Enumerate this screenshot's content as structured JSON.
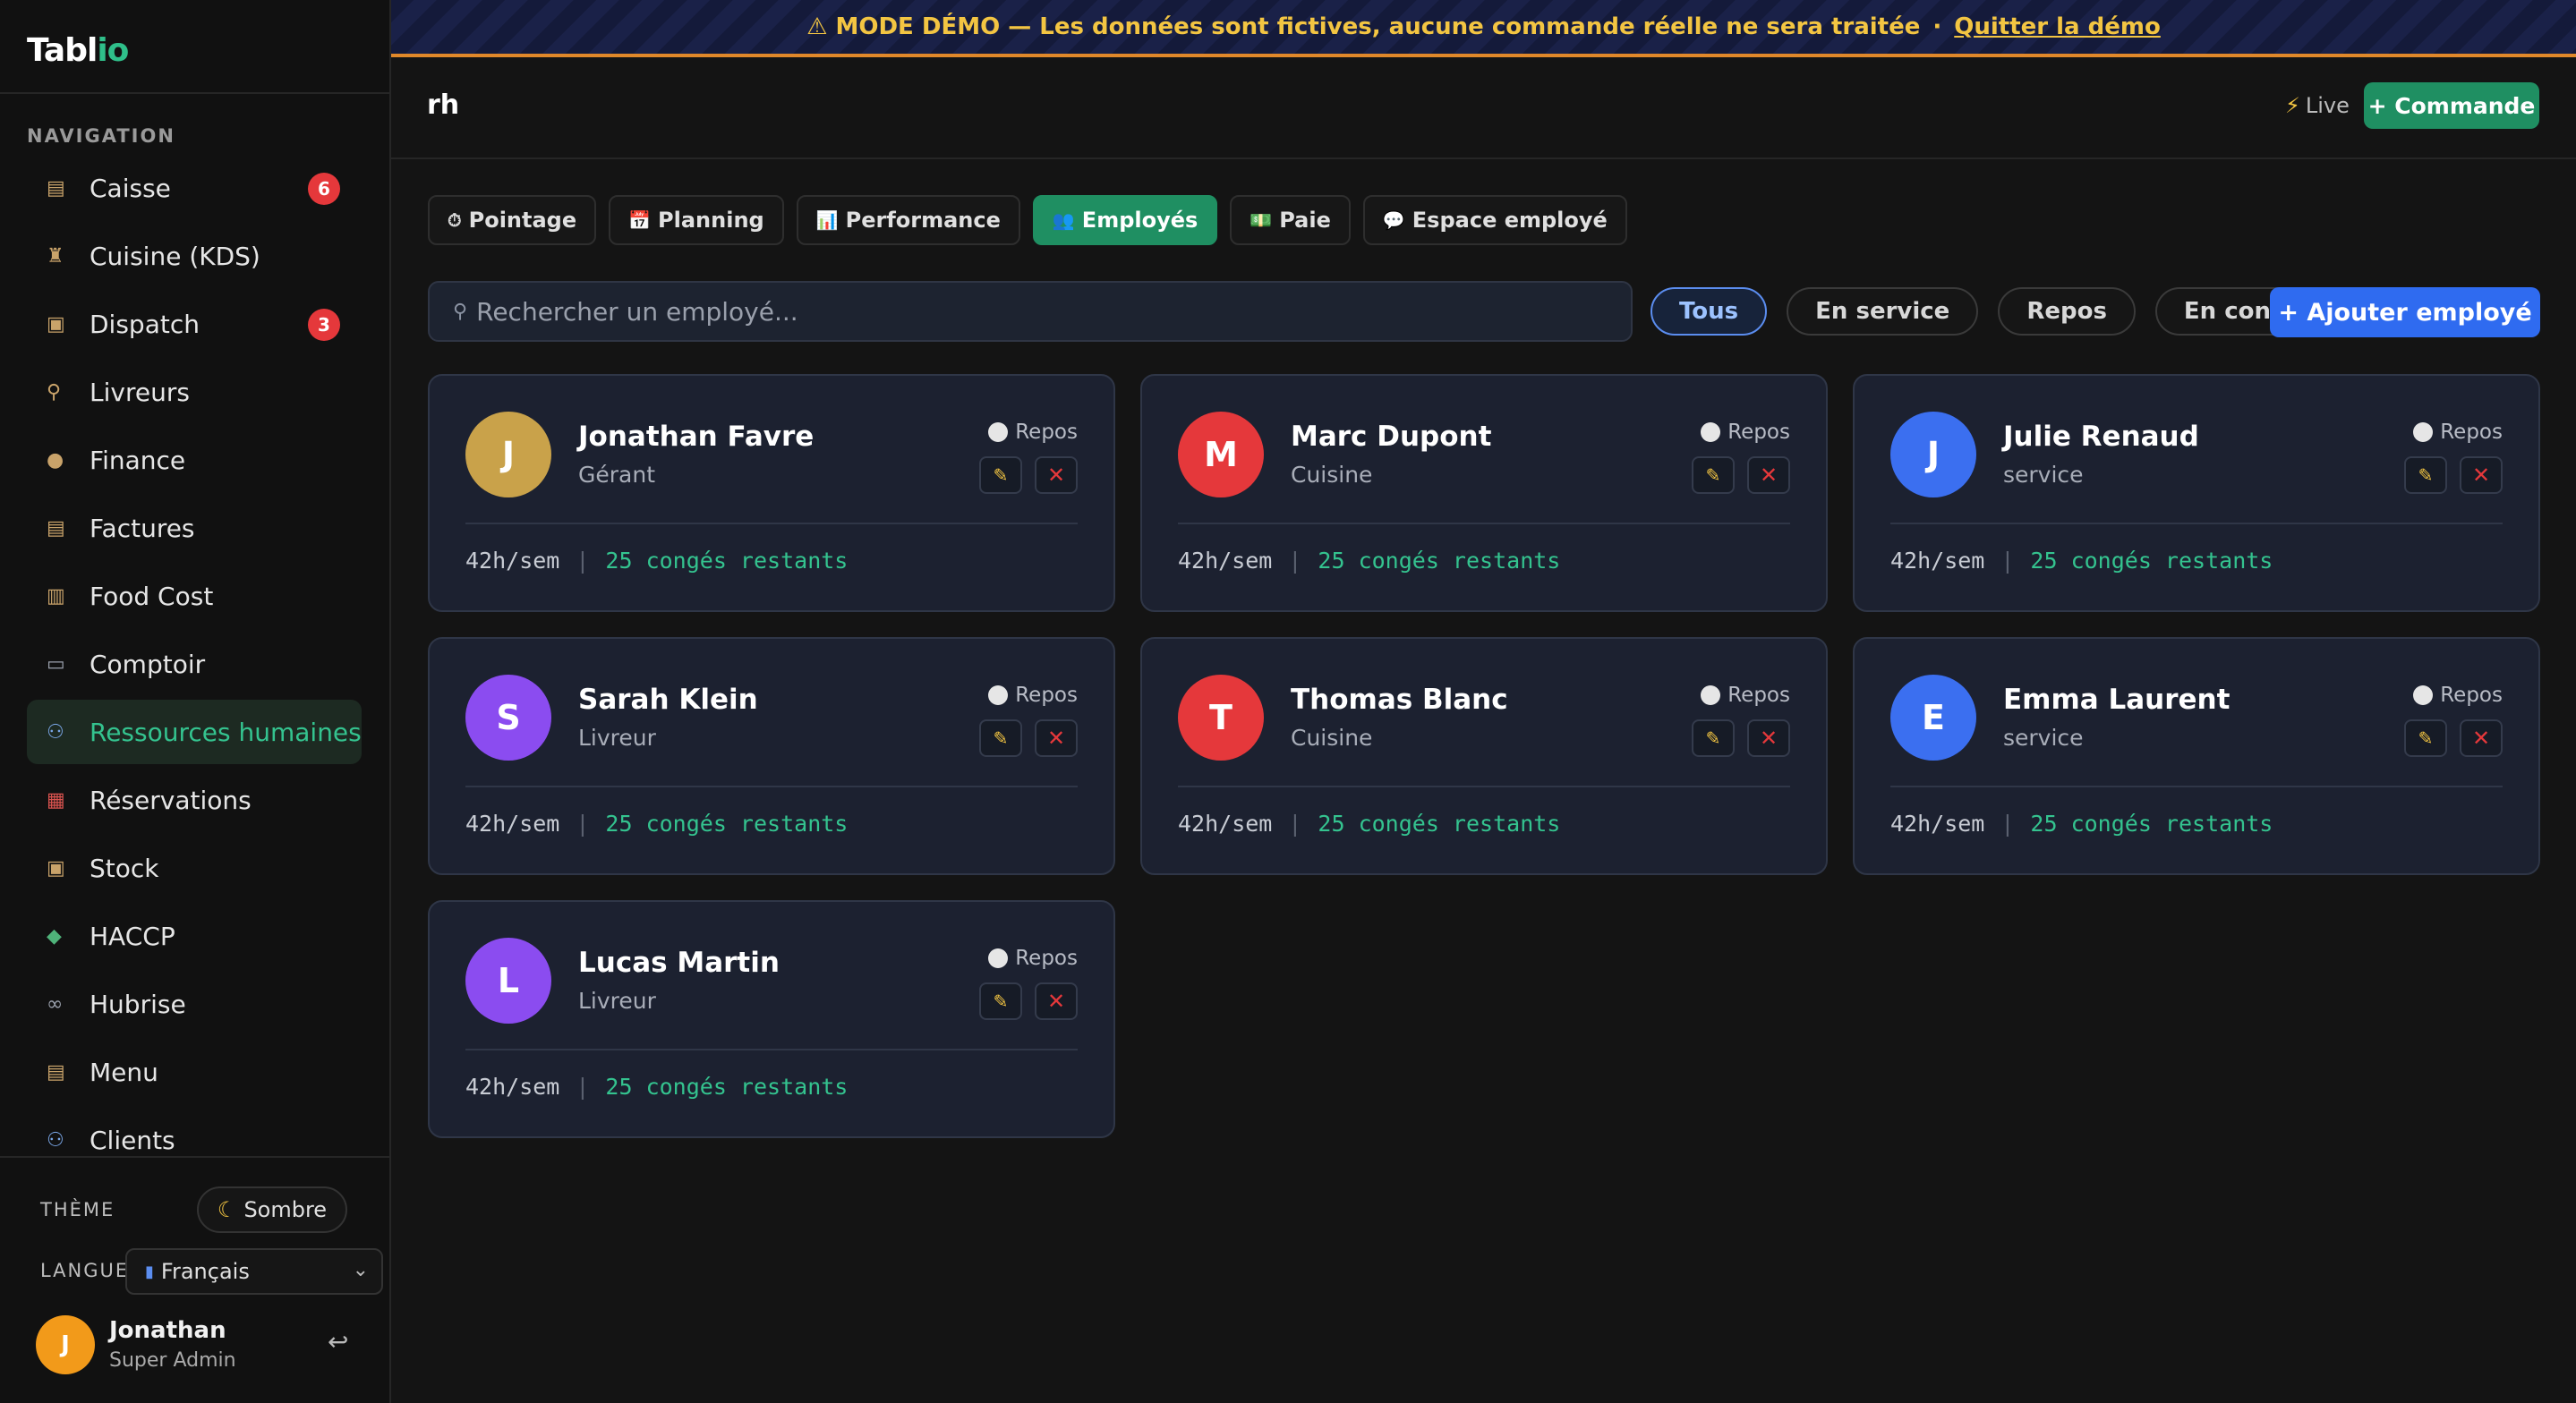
{
  "app": {
    "logo_main": "Tabl",
    "logo_accent": "io"
  },
  "sidebar": {
    "nav_heading": "NAVIGATION",
    "items": [
      {
        "label": "Caisse",
        "icon": "register-icon",
        "badge": "6"
      },
      {
        "label": "Cuisine (KDS)",
        "icon": "chef-icon",
        "badge": ""
      },
      {
        "label": "Dispatch",
        "icon": "package-icon",
        "badge": "3"
      },
      {
        "label": "Livreurs",
        "icon": "runner-icon",
        "badge": ""
      },
      {
        "label": "Finance",
        "icon": "moneybag-icon",
        "badge": ""
      },
      {
        "label": "Factures",
        "icon": "invoice-icon",
        "badge": ""
      },
      {
        "label": "Food Cost",
        "icon": "chart-icon",
        "badge": ""
      },
      {
        "label": "Comptoir",
        "icon": "monitor-icon",
        "badge": ""
      },
      {
        "label": "Ressources humaines",
        "icon": "people-icon",
        "badge": "",
        "active": true
      },
      {
        "label": "Réservations",
        "icon": "calendar-icon",
        "badge": ""
      },
      {
        "label": "Stock",
        "icon": "box-icon",
        "badge": ""
      },
      {
        "label": "HACCP",
        "icon": "thermometer-icon",
        "badge": ""
      },
      {
        "label": "Hubrise",
        "icon": "link-icon",
        "badge": ""
      },
      {
        "label": "Menu",
        "icon": "clipboard-icon",
        "badge": ""
      },
      {
        "label": "Clients",
        "icon": "people-icon",
        "badge": ""
      }
    ],
    "theme_label": "THÈME",
    "theme_value": "Sombre",
    "lang_label": "LANGUE",
    "lang_value": "Français",
    "user": {
      "initial": "J",
      "name": "Jonathan",
      "role": "Super Admin"
    }
  },
  "banner": {
    "text": "⚠ MODE DÉMO — Les données sont fictives, aucune commande réelle ne sera traitée",
    "separator": "·",
    "quit_label": "Quitter la démo"
  },
  "header": {
    "title": "rh",
    "live_label": "Live",
    "command_label": "+ Commande"
  },
  "tabs": [
    {
      "label": "Pointage",
      "icon": "⏱"
    },
    {
      "label": "Planning",
      "icon": "📅"
    },
    {
      "label": "Performance",
      "icon": "📊"
    },
    {
      "label": "Employés",
      "icon": "👥",
      "active": true
    },
    {
      "label": "Paie",
      "icon": "💵"
    },
    {
      "label": "Espace employé",
      "icon": "💬"
    }
  ],
  "search": {
    "placeholder": "Rechercher un employé..."
  },
  "filters": [
    {
      "label": "Tous",
      "active": true
    },
    {
      "label": "En service"
    },
    {
      "label": "Repos"
    },
    {
      "label": "En congé"
    }
  ],
  "add_employee_label": "+ Ajouter employé",
  "employees": [
    {
      "initial": "J",
      "name": "Jonathan Favre",
      "role": "Gérant",
      "status": "Repos",
      "hours": "42h/sem",
      "leave": "25 congés restants",
      "color": "#c9a24a"
    },
    {
      "initial": "M",
      "name": "Marc Dupont",
      "role": "Cuisine",
      "status": "Repos",
      "hours": "42h/sem",
      "leave": "25 congés restants",
      "color": "#e5383b"
    },
    {
      "initial": "J",
      "name": "Julie Renaud",
      "role": "service",
      "status": "Repos",
      "hours": "42h/sem",
      "leave": "25 congés restants",
      "color": "#3b6ff0"
    },
    {
      "initial": "S",
      "name": "Sarah Klein",
      "role": "Livreur",
      "status": "Repos",
      "hours": "42h/sem",
      "leave": "25 congés restants",
      "color": "#8b4cf0"
    },
    {
      "initial": "T",
      "name": "Thomas Blanc",
      "role": "Cuisine",
      "status": "Repos",
      "hours": "42h/sem",
      "leave": "25 congés restants",
      "color": "#e5383b"
    },
    {
      "initial": "E",
      "name": "Emma Laurent",
      "role": "service",
      "status": "Repos",
      "hours": "42h/sem",
      "leave": "25 congés restants",
      "color": "#3b6ff0"
    },
    {
      "initial": "L",
      "name": "Lucas Martin",
      "role": "Livreur",
      "status": "Repos",
      "hours": "42h/sem",
      "leave": "25 congés restants",
      "color": "#8b4cf0"
    }
  ]
}
